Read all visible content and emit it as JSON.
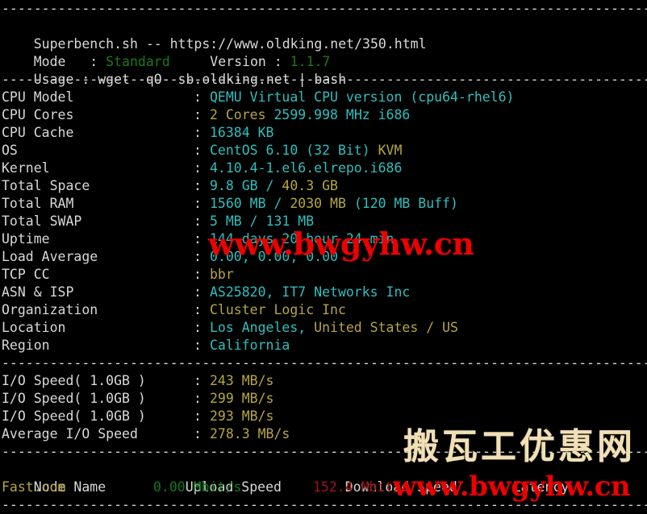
{
  "terminal": {
    "separator": "----------------------------------------------------------------------",
    "header": {
      "title": "Superbench.sh -- https://www.oldking.net/350.html",
      "mode_label": "Mode   : ",
      "mode_value": "Standard",
      "version_label": "     Version : ",
      "version_value": "1.1.7",
      "usage": "Usage : wget -qO- sb.oldking.net | bash"
    },
    "info_rows": [
      {
        "label": "CPU Model",
        "colon": ":",
        "value_a": "QEMU Virtual CPU version (cpu64-rhel6)",
        "value_b": ""
      },
      {
        "label": "CPU Cores",
        "colon": ":",
        "value_a": "2 Cores ",
        "value_b": "2599.998 MHz i686",
        "a_color": "yellow",
        "b_color": "cyan"
      },
      {
        "label": "CPU Cache",
        "colon": ":",
        "value_a": "16384 KB",
        "value_b": ""
      },
      {
        "label": "OS",
        "colon": ":",
        "value_a": "CentOS 6.10 (32 Bit) ",
        "value_b": "KVM",
        "a_color": "cyan",
        "b_color": "yellow"
      },
      {
        "label": "Kernel",
        "colon": ":",
        "value_a": "4.10.4-1.el6.elrepo.i686",
        "value_b": ""
      },
      {
        "label": "Total Space",
        "colon": ":",
        "value_a": "9.8 GB / ",
        "value_b": "40.3 GB",
        "a_color": "cyan",
        "b_color": "yellow"
      },
      {
        "label": "Total RAM",
        "colon": ":",
        "value_a": "1560 MB / ",
        "value_b": "2030 MB",
        "b_color": "yellow",
        "value_c": " (120 MB Buff)"
      },
      {
        "label": "Total SWAP",
        "colon": ":",
        "value_a": "5 MB / 131 MB",
        "value_b": ""
      },
      {
        "label": "Uptime",
        "colon": ":",
        "value_a": "144 days 20 hour 24 min",
        "value_b": ""
      },
      {
        "label": "Load Average",
        "colon": ":",
        "value_a": "0.00, 0.00, 0.00",
        "value_b": ""
      },
      {
        "label": "TCP CC",
        "colon": ":",
        "value_a": "bbr",
        "value_b": "",
        "a_color": "yellow"
      },
      {
        "label": "ASN & ISP",
        "colon": ":",
        "value_a": "AS25820, IT7 Networks Inc",
        "value_b": ""
      },
      {
        "label": "Organization",
        "colon": ":",
        "value_a": "Cluster Logic Inc",
        "value_b": "",
        "a_color": "yellow"
      },
      {
        "label": "Location",
        "colon": ":",
        "value_a": "Los Angeles, ",
        "value_b": "United States / US",
        "a_color": "cyan",
        "b_color": "yellow"
      },
      {
        "label": "Region",
        "colon": ":",
        "value_a": "California",
        "value_b": ""
      }
    ],
    "io_rows": [
      {
        "label": "I/O Speed( 1.0GB )",
        "colon": ":",
        "value": "243 MB/s"
      },
      {
        "label": "I/O Speed( 1.0GB )",
        "colon": ":",
        "value": "299 MB/s"
      },
      {
        "label": "I/O Speed( 1.0GB )",
        "colon": ":",
        "value": "293 MB/s"
      },
      {
        "label": "Average I/O Speed",
        "colon": ":",
        "value": "278.3 MB/s"
      }
    ],
    "speed_table": {
      "headers": {
        "node": "Node Name",
        "upload": "Upload Speed",
        "download": "Download Speed",
        "latency": "Latency"
      },
      "rows": [
        {
          "node": "Fast.com",
          "upload": "0.00 Mbit/s",
          "download": "152.4 Mbit/s",
          "latency": ""
        }
      ]
    },
    "watermarks": {
      "url_top": "www.bwgyhw.cn",
      "url_bottom": "www.bwgyhw.cn",
      "site_cn": "搬瓦工优惠网"
    },
    "colors": {
      "background": "#000000",
      "foreground": "#d8d8d8",
      "cyan": "#2fbfbf",
      "yellow": "#b5a642",
      "green": "#1a7a1a",
      "red": "#a01414",
      "watermark_red": "#ee0000",
      "watermark_tan": "#f0e0b8"
    }
  }
}
